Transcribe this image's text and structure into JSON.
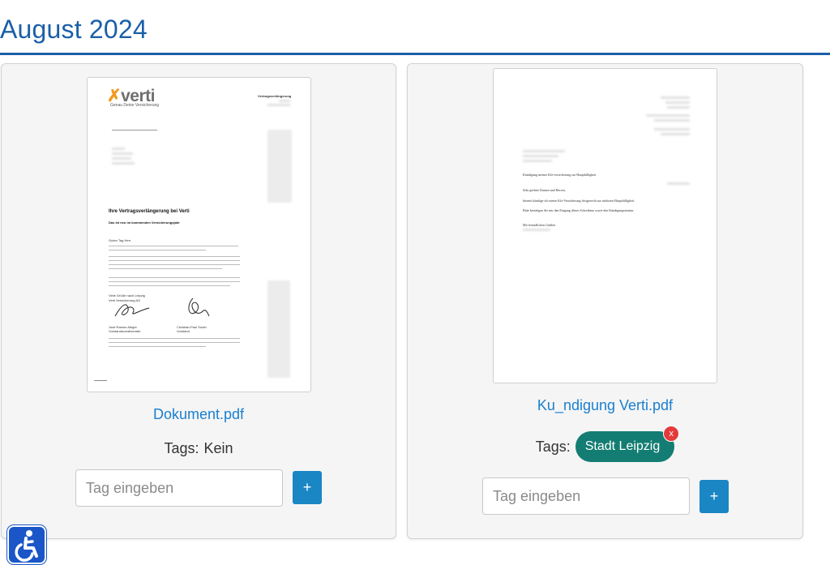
{
  "page": {
    "title": "August 2024"
  },
  "documents": [
    {
      "filename": "Dokument.pdf",
      "tags_label": "Tags:",
      "tags_none": "Kein",
      "tags": [],
      "input_placeholder": "Tag eingeben",
      "add_button_label": "+",
      "thumbnail": {
        "logo_text": "verti",
        "tagline": "Genau Deine Versicherung",
        "header_right": "Vertragsverlängerung",
        "heading": "Ihre Vertragsverlängerung bei Verti",
        "subheading": "Das ist neu im kommenden Versicherungsjahr",
        "greeting": "Guten Tag Herr",
        "closing": "Viele Grüße nach Leipzig",
        "company": "Verti Versicherung AG",
        "signer_1": "José Ramón Alegre",
        "signer_1_role": "Vorstandsvorsitzender",
        "signer_2": "Christian-Paul Sooth",
        "signer_2_role": "Vorstand"
      }
    },
    {
      "filename": "Ku_ndigung Verti.pdf",
      "tags_label": "Tags:",
      "tags": [
        {
          "label": "Stadt Leipzig",
          "remove_label": "x"
        }
      ],
      "input_placeholder": "Tag eingeben",
      "add_button_label": "+",
      "thumbnail": {
        "subject": "Kündigung meiner Kfz-versicherung zur Hauptfälligkeit",
        "salutation": "Sehr geehrte Damen und Herren,",
        "body_1": "hiermit kündige ich meine Kfz-Versicherung fristgerecht zur nächsten Hauptfälligkeit.",
        "body_2": "Bitte bestätigen Sie mir den Eingang dieses Schreibens sowie den Kündigungstermin.",
        "closing": "Mit freundlichen Grüßen"
      }
    }
  ],
  "accessibility": {
    "icon": "wheelchair-icon"
  },
  "colors": {
    "title": "#1a5fa8",
    "link": "#1a7fd0",
    "tag": "#147d73",
    "add_button": "#1a86c4",
    "remove": "#e33b3b",
    "a11y": "#1a56c8"
  }
}
